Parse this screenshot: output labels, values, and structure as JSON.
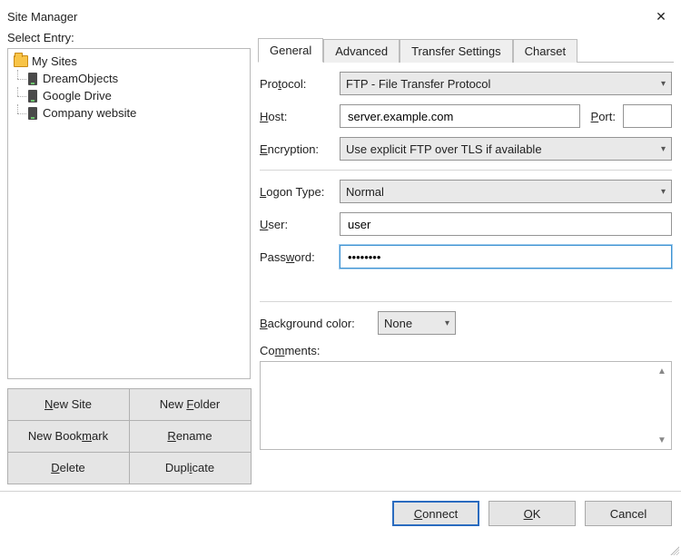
{
  "window": {
    "title": "Site Manager"
  },
  "left": {
    "select_entry_label": "Select Entry:",
    "root_label": "My Sites",
    "sites": [
      {
        "label": "DreamObjects"
      },
      {
        "label": "Google Drive"
      },
      {
        "label": "Company website"
      }
    ],
    "buttons": {
      "new_site": "New Site",
      "new_folder": "New Folder",
      "new_bookmark": "New Bookmark",
      "rename": "Rename",
      "delete": "Delete",
      "duplicate": "Duplicate"
    }
  },
  "tabs": {
    "general": "General",
    "advanced": "Advanced",
    "transfer": "Transfer Settings",
    "charset": "Charset",
    "active": "general"
  },
  "form": {
    "protocol_label": "Protocol:",
    "protocol_value": "FTP - File Transfer Protocol",
    "host_label": "Host:",
    "host_value": "server.example.com",
    "port_label": "Port:",
    "port_value": "",
    "encryption_label": "Encryption:",
    "encryption_value": "Use explicit FTP over TLS if available",
    "logon_type_label": "Logon Type:",
    "logon_type_value": "Normal",
    "user_label": "User:",
    "user_value": "user",
    "password_label": "Password:",
    "password_value": "••••••••",
    "bg_color_label": "Background color:",
    "bg_color_value": "None",
    "comments_label": "Comments:",
    "comments_value": ""
  },
  "footer": {
    "connect": "Connect",
    "ok": "OK",
    "cancel": "Cancel"
  }
}
